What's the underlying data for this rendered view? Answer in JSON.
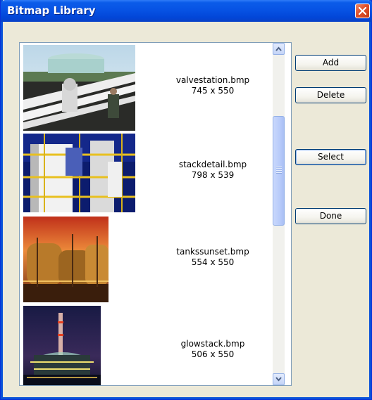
{
  "window": {
    "title": "Bitmap Library"
  },
  "bitmaps": [
    {
      "filename": "valvestation.bmp",
      "dimensions": "745 x 550",
      "thumbnail": "pipeline valve station photo"
    },
    {
      "filename": "stackdetail.bmp",
      "dimensions": "798 x 539",
      "thumbnail": "industrial stack at night photo"
    },
    {
      "filename": "tankssunset.bmp",
      "dimensions": "554 x 550",
      "thumbnail": "storage tanks at sunset photo"
    },
    {
      "filename": "glowstack.bmp",
      "dimensions": "506 x 550",
      "thumbnail": "glowing refinery stack photo"
    }
  ],
  "buttons": {
    "add": "Add",
    "delete": "Delete",
    "select": "Select",
    "done": "Done"
  },
  "scrollbar": {
    "up_icon": "arrow-up-icon",
    "down_icon": "arrow-down-icon"
  },
  "colors": {
    "titlebar": "#0753e4",
    "close": "#e0502a",
    "dialog": "#ece9d8"
  }
}
